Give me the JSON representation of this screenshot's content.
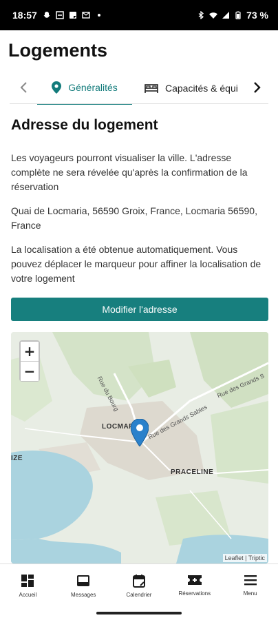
{
  "status_bar": {
    "time": "18:57",
    "battery": "73 %"
  },
  "header": {
    "title": "Logements"
  },
  "tabs": [
    {
      "label": "Généralités",
      "icon": "location-pin-icon",
      "active": true
    },
    {
      "label": "Capacités & équi",
      "icon": "bed-icon",
      "active": false
    }
  ],
  "content": {
    "section_title": "Adresse du logement",
    "info_text": "Les voyageurs pourront visualiser la ville. L'adresse complète ne sera révelée qu'après la confirmation de la réservation",
    "address": "Quai de Locmaria, 56590 Groix, France, Locmaria 56590, France",
    "location_note": "La localisation a été obtenue automatiquement. Vous pouvez déplacer le marqueur pour affiner la localisation de votre logement",
    "modify_button": "Modifier l'adresse"
  },
  "map": {
    "zoom_in": "+",
    "zoom_out": "−",
    "labels": {
      "locmaria": "LOCMAR",
      "praceline": "PRACELINE",
      "left_edge": "IZE",
      "rue_bourg": "Rue du Bourg",
      "rue_grands_sables_1": "Rue des Grands Sables",
      "rue_grands_sables_2": "Rue des Grands S"
    },
    "attribution": "Leaflet | Triptic"
  },
  "bottom_nav": [
    {
      "label": "Accueil",
      "icon": "dashboard-icon"
    },
    {
      "label": "Messages",
      "icon": "inbox-icon"
    },
    {
      "label": "Calendrier",
      "icon": "calendar-icon"
    },
    {
      "label": "Réservations",
      "icon": "ticket-icon"
    },
    {
      "label": "Menu",
      "icon": "menu-icon"
    }
  ],
  "colors": {
    "accent": "#177f7e",
    "tab_active": "#127b7b",
    "marker": "#2a81cb"
  }
}
